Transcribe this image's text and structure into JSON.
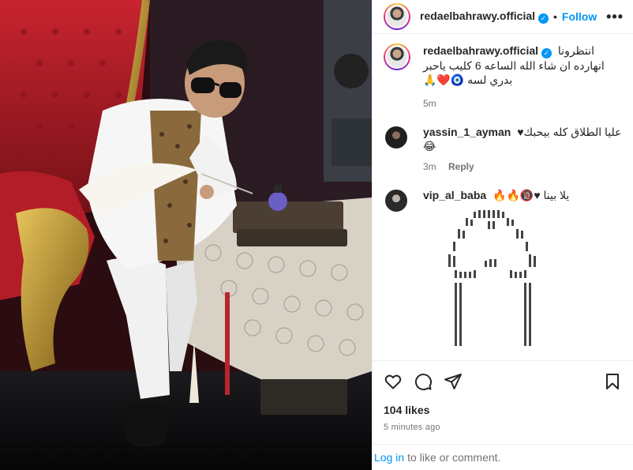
{
  "header": {
    "username": "redaelbahrawy.official",
    "follow_label": "Follow",
    "more_label": "•••"
  },
  "caption": {
    "username": "redaelbahrawy.official",
    "text_line1": "انتظرونا",
    "text_line2": "انهارده ان شاء الله الساعه 6 كليب ياحبر",
    "text_line3": "بدري لسه 🧿❤️🙏",
    "time": "5m"
  },
  "comments": [
    {
      "username": "yassin_1_ayman",
      "text": "عليا الطلاق كله بيحبك♥",
      "emoji": "😂",
      "time": "3m",
      "reply_label": "Reply"
    },
    {
      "username": "vip_al_baba",
      "text": "يلا بينا ♥🔞🔥🔥"
    }
  ],
  "actions": {
    "likes": "104 likes",
    "time": "5 minutes ago"
  },
  "login": {
    "link_label": "Log in",
    "text": "to like or comment."
  },
  "icons": {
    "like": "heart-icon",
    "comment": "comment-icon",
    "share": "share-icon",
    "save": "bookmark-icon",
    "verified": "verified-badge-icon"
  },
  "colors": {
    "accent": "#0095f6",
    "text": "#262626",
    "muted": "#737373"
  }
}
